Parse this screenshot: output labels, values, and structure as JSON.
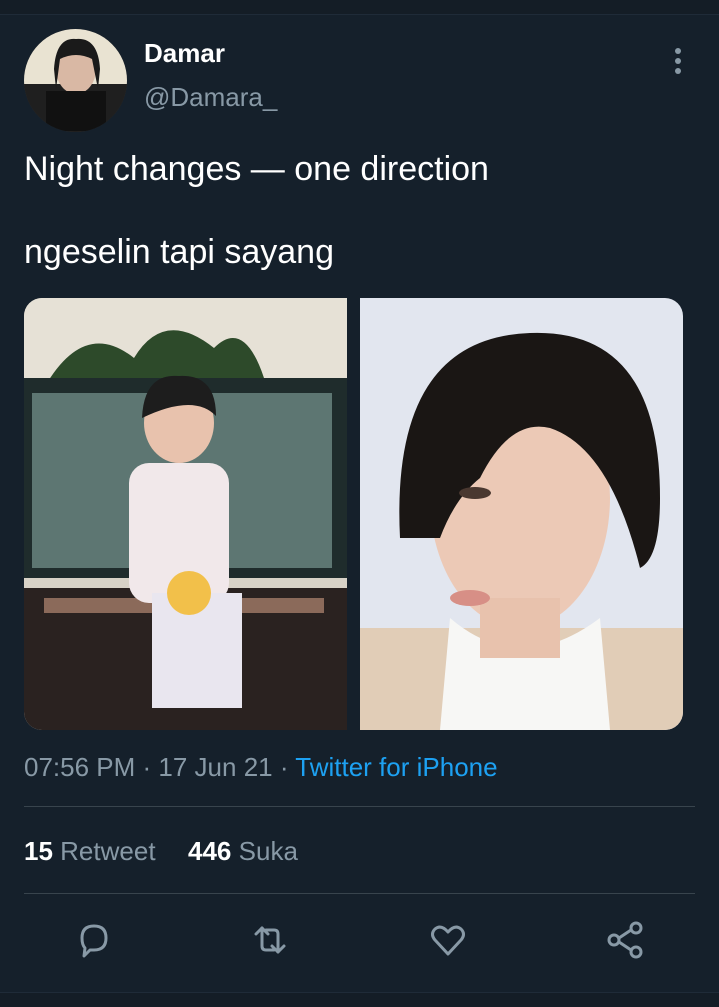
{
  "tweet": {
    "display_name": "Damar",
    "handle": "@Damara_",
    "line1": "Night changes — one direction",
    "line2": "ngeselin tapi sayang",
    "time": "07:56 PM",
    "date": "17 Jun 21",
    "source": "Twitter for iPhone",
    "separator": " · "
  },
  "stats": {
    "retweets_count": "15",
    "retweets_label": "Retweet",
    "likes_count": "446",
    "likes_label": "Suka"
  },
  "icons": {
    "more": "more-vertical-icon",
    "reply": "reply-icon",
    "retweet": "retweet-icon",
    "like": "heart-icon",
    "share": "share-icon"
  },
  "colors": {
    "background": "#15202b",
    "text": "#ffffff",
    "muted": "#8899a6",
    "link": "#1da1f2",
    "divider": "#38444d"
  }
}
